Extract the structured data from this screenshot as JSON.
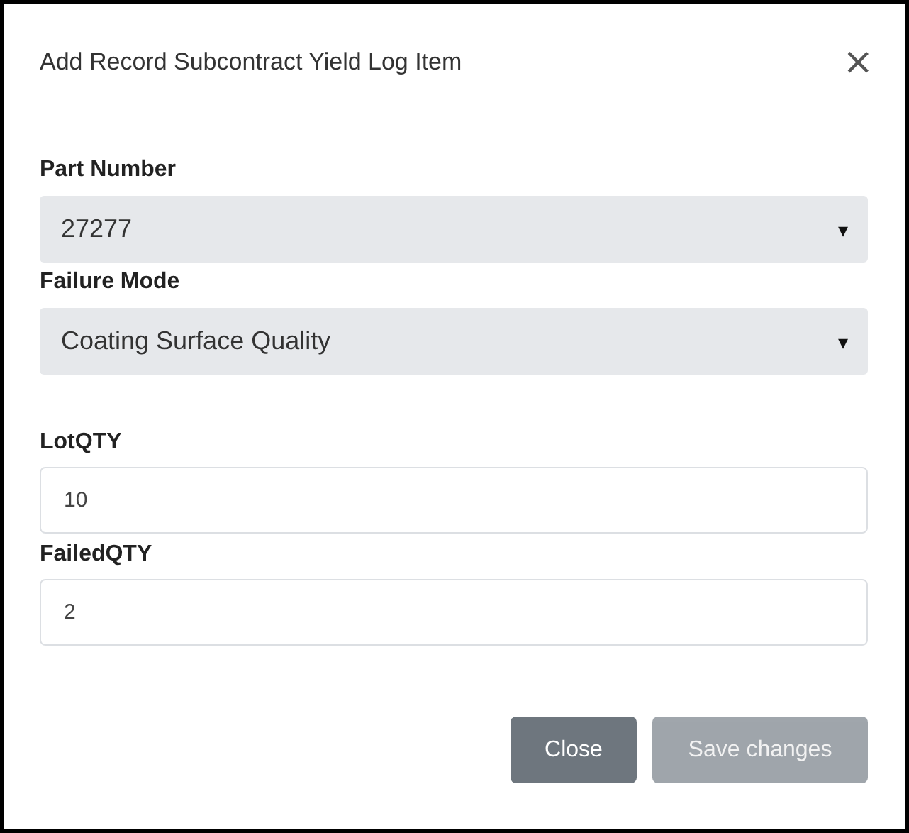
{
  "dialog": {
    "title": "Add Record Subcontract Yield Log Item",
    "close_icon": "×"
  },
  "fields": [
    {
      "kind": "select",
      "label": "Part Number",
      "value": "27277",
      "caret": "▾"
    },
    {
      "kind": "select",
      "label": "Failure Mode",
      "value": "Coating Surface Quality",
      "caret": "▾"
    },
    {
      "kind": "input",
      "label": "LotQTY",
      "value": "10"
    },
    {
      "kind": "input",
      "label": "FailedQTY",
      "value": "2"
    }
  ],
  "buttons": [
    {
      "label": "Close",
      "kind": "secondary",
      "disabled": false
    },
    {
      "label": "Save changes",
      "kind": "primary",
      "disabled": true
    }
  ]
}
